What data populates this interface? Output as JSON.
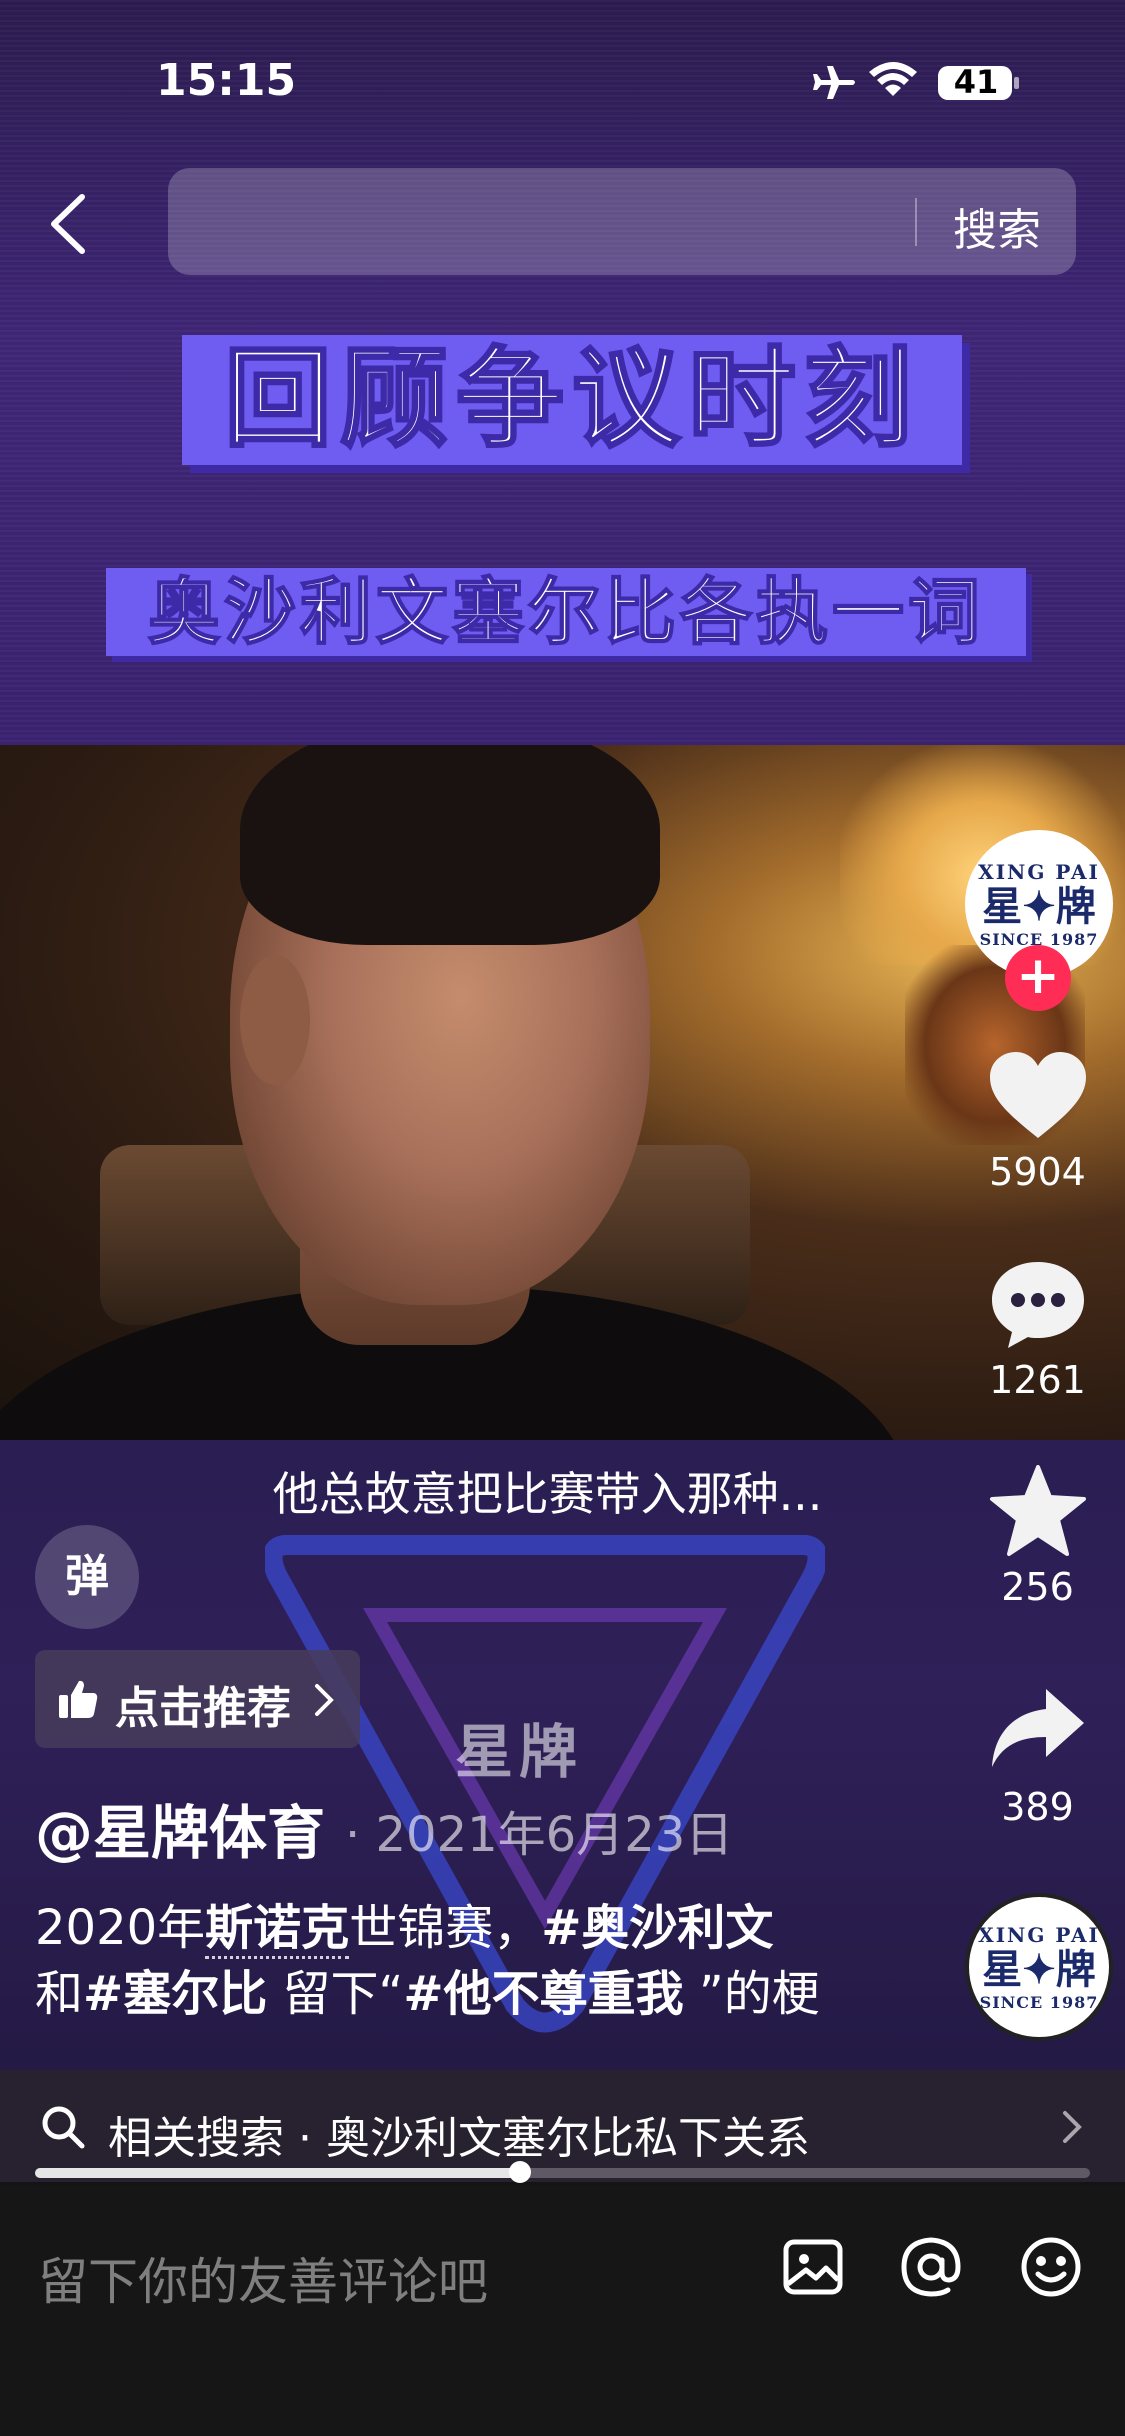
{
  "status_bar": {
    "time": "15:15",
    "battery": "41"
  },
  "nav": {
    "search_button": "搜索",
    "search_placeholder": ""
  },
  "video": {
    "title_line1": "回顾争议时刻",
    "title_line2": "奥沙利文塞尔比各执一词",
    "caption": "他总故意把比赛带入那种...",
    "watermark": "星牌"
  },
  "overlay": {
    "danmaku_label": "弹",
    "recommend_label": "点击推荐"
  },
  "post": {
    "author": "@星牌体育",
    "date": "· 2021年6月23日",
    "desc_prefix": "2020年",
    "desc_link": "斯诺克",
    "desc_mid": "世锦赛，",
    "desc_tag1": "#奥沙利文",
    "desc_line2_prefix": "和",
    "desc_tag2": "#塞尔比",
    "desc_line2_mid": " 留下“",
    "desc_tag3": "#他不尊重我",
    "desc_line2_end": " ”的梗"
  },
  "actions": {
    "follow": "+",
    "likes": "5904",
    "comments": "1261",
    "favorites": "256",
    "shares": "389"
  },
  "brand_logo": {
    "top": "XING PAI",
    "main": "星✦牌",
    "bottom": "SINCE 1987"
  },
  "related": {
    "text": "相关搜索 · 奥沙利文塞尔比私下关系"
  },
  "playback": {
    "progress": 0.46
  },
  "comment_bar": {
    "placeholder": "留下你的友善评论吧"
  },
  "colors": {
    "accent": "#ff2d55",
    "title_bg": "#6f5cf1"
  }
}
